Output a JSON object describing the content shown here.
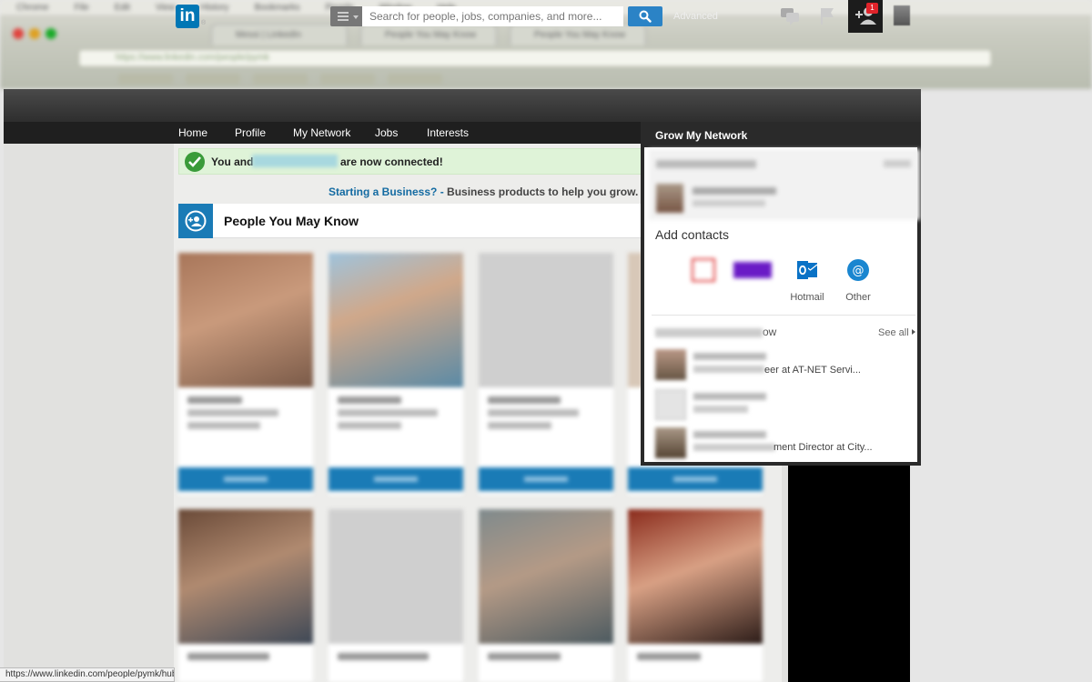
{
  "browser": {
    "menu_items": [
      "Chrome",
      "File",
      "Edit",
      "View",
      "History",
      "Bookmarks",
      "People",
      "Window",
      "Help"
    ],
    "tabs": [
      "Messi | LinkedIn",
      "People You May Know",
      "People You May Know"
    ],
    "url": "https://www.linkedin.com/people/pymk"
  },
  "topbar": {
    "logo_text": "in",
    "search_placeholder": "Search for people, jobs, companies, and more...",
    "advanced_label": "Advanced",
    "notification_count": "1"
  },
  "nav": {
    "items": [
      "Home",
      "Profile",
      "My Network",
      "Jobs",
      "Interests"
    ]
  },
  "notice": {
    "prefix": "You and",
    "suffix": "are now connected!"
  },
  "ad": {
    "link_text": "Starting a Business? -",
    "text": "Business products to help you grow. W"
  },
  "pymk": {
    "title": "People You May Know"
  },
  "dropdown": {
    "title": "Grow My Network",
    "add_contacts": "Add contacts",
    "providers": [
      {
        "label": "Hotmail",
        "icon": "outlook-icon"
      },
      {
        "label": "Other",
        "icon": "at-icon"
      }
    ],
    "pymk_suffix": "ow",
    "see_all": "See all",
    "suggestions": [
      {
        "text": "eer at AT-NET Servi..."
      },
      {
        "text": ""
      },
      {
        "text": "ment Director at City..."
      }
    ]
  },
  "statusbar": {
    "url": "https://www.linkedin.com/people/pymk/hub"
  },
  "colors": {
    "brand": "#0077b5",
    "topbar": "#333333",
    "connect_button": "#1a7bb6",
    "badge": "#e0232a",
    "success": "#3a9b3a"
  }
}
